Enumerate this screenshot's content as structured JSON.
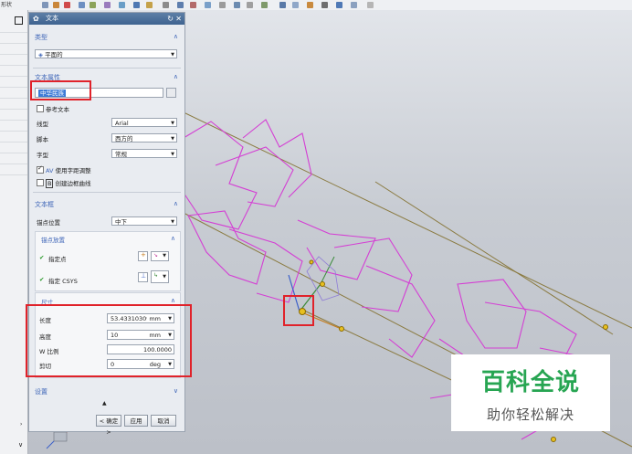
{
  "toolbar": {
    "left_label": "形状"
  },
  "dialog": {
    "title": "文本",
    "sections": {
      "type": {
        "title": "类型",
        "value": "平面的"
      },
      "text_props": {
        "title": "文本属性",
        "text_value": "中华民族",
        "ref_text_label": "参考文本",
        "line_label": "线型",
        "line_value": "Arial",
        "script_label": "脚本",
        "script_value": "西方的",
        "style_label": "字型",
        "style_value": "常规",
        "kerning_label": "使用字距调整",
        "border_label": "创建边框曲线"
      },
      "text_box": {
        "title": "文本框",
        "anchor_label": "锚点位置",
        "anchor_value": "中下",
        "anchor_place_title": "锚点放置",
        "point_label": "指定点",
        "csys_label": "指定 CSYS"
      },
      "dimension": {
        "title": "尺寸",
        "length_label": "长度",
        "length_value": "53.43310309",
        "length_unit": "mm",
        "height_label": "高度",
        "height_value": "10",
        "height_unit": "mm",
        "wscale_label": "W 比例",
        "wscale_value": "100.0000",
        "shear_label": "剪切",
        "shear_value": "0",
        "shear_unit": "deg"
      },
      "settings": {
        "title": "设置"
      }
    },
    "buttons": {
      "ok": "< 确定 >",
      "apply": "应用",
      "cancel": "取消"
    }
  },
  "watermark": {
    "title": "百科全说",
    "subtitle": "助你轻松解决"
  },
  "colors": {
    "accent": "#3f66b8",
    "highlight": "#e0222a",
    "text_curve": "#d43fd4",
    "watermark_green": "#27a552"
  }
}
